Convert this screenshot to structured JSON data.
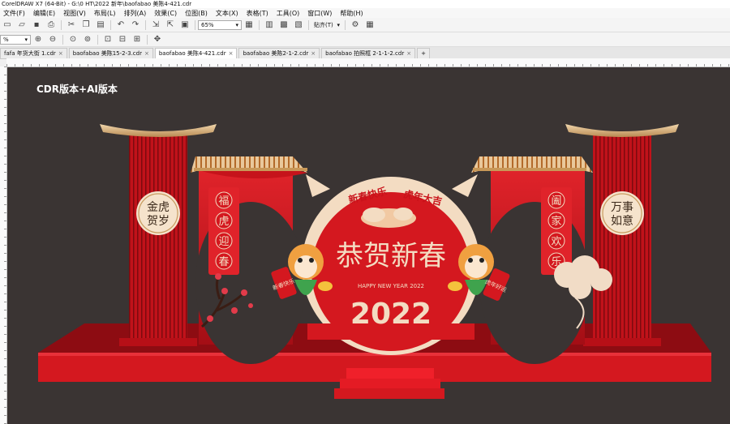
{
  "window": {
    "title": "CorelDRAW X7 (64-Bit) - G:\\0 HT\\2022 新年\\baofabao 美陈4-421.cdr"
  },
  "menu": [
    "文件(F)",
    "编辑(E)",
    "视图(V)",
    "布局(L)",
    "排列(A)",
    "效果(C)",
    "位图(B)",
    "文本(X)",
    "表格(T)",
    "工具(O)",
    "窗口(W)",
    "帮助(H)"
  ],
  "toolbar": {
    "zoom_value": "65%",
    "snap_label": "贴齐(T)"
  },
  "property_bar": {
    "zoom_value": "%"
  },
  "tabs": [
    {
      "label": "fafa 年货大街 1.cdr",
      "active": false
    },
    {
      "label": "baofabao 美陈15-2-3.cdr",
      "active": false
    },
    {
      "label": "baofabao 美陈4-421.cdr",
      "active": true
    },
    {
      "label": "baofabao 美陈2-1-2.cdr",
      "active": false
    },
    {
      "label": "baofabao 拍照框 2-1-1-2.cdr",
      "active": false
    }
  ],
  "tab_add": "+",
  "tab_close": "×",
  "artwork": {
    "version_label": "CDR版本+AI版本",
    "arch_slogan_left": "新春快乐",
    "arch_slogan_right": "虎年大吉",
    "main_title": "恭贺新春",
    "sub_title": "HAPPY NEW YEAR 2022",
    "year": "2022",
    "left_couplet": [
      "福",
      "虎",
      "迎",
      "春"
    ],
    "right_couplet": [
      "阖",
      "家",
      "欢",
      "乐"
    ],
    "left_badge": [
      "金虎",
      "贺岁"
    ],
    "right_badge": [
      "万事",
      "如意"
    ],
    "left_scroll": "新春快乐",
    "right_scroll": "虎年好运",
    "colors": {
      "canvas": "#3a3433",
      "red": "#d0121b",
      "dark_red": "#a80d14",
      "gold": "#d9b98a",
      "cream": "#f3dcc2"
    }
  }
}
